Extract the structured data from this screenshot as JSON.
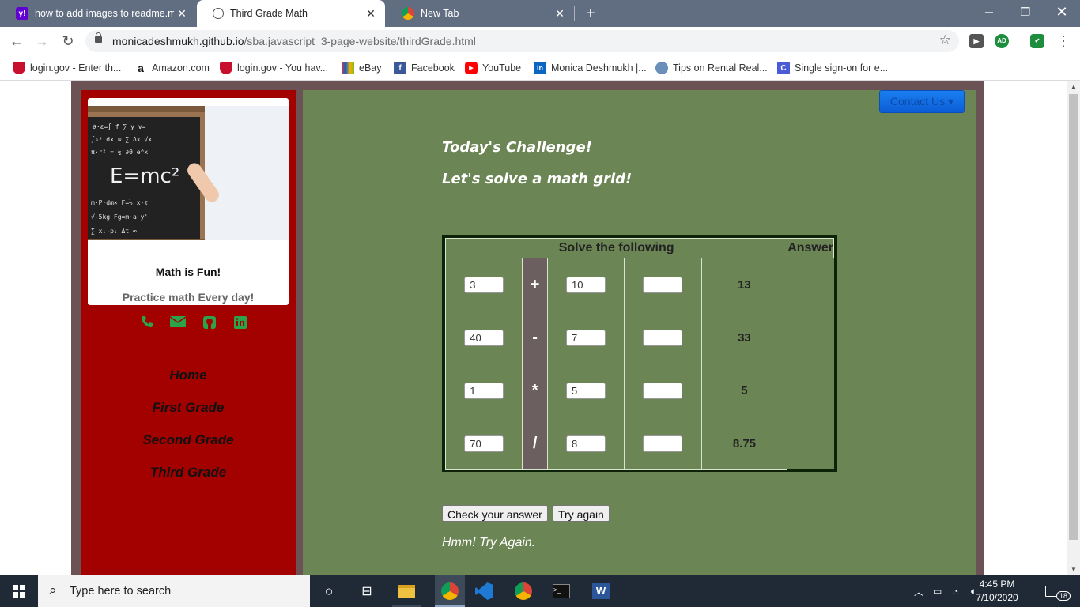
{
  "browser": {
    "tabs": [
      {
        "label": "how to add images to readme.m",
        "favicon": "yahoo-icon",
        "active": false
      },
      {
        "label": "Third Grade Math",
        "favicon": "globe-icon",
        "active": true
      },
      {
        "label": "New Tab",
        "favicon": "chrome-icon",
        "active": false
      }
    ],
    "url_host": "monicadeshmukh.github.io",
    "url_path": "/sba.javascript_3-page-website/thirdGrade.html",
    "profile_initials": "AD",
    "bookmarks": [
      {
        "label": "login.gov - Enter th...",
        "icon": "shield-icon"
      },
      {
        "label": "Amazon.com",
        "icon": "amazon-icon"
      },
      {
        "label": "login.gov - You hav...",
        "icon": "shield-icon"
      },
      {
        "label": "eBay",
        "icon": "shopping-bag-icon"
      },
      {
        "label": "Facebook",
        "icon": "facebook-icon"
      },
      {
        "label": "YouTube",
        "icon": "youtube-icon"
      },
      {
        "label": "Monica Deshmukh |...",
        "icon": "linkedin-icon"
      },
      {
        "label": "Tips on Rental Real...",
        "icon": "globe-icon"
      },
      {
        "label": "Single sign-on for e...",
        "icon": "sso-icon"
      }
    ]
  },
  "sidebar": {
    "card_title": "Math is Fun!",
    "card_subtitle": "Practice math Every day!",
    "image_text": "E=mc²",
    "social_icons": [
      "phone-icon",
      "mail-icon",
      "github-icon",
      "linkedin-icon"
    ],
    "nav": [
      "Home",
      "First Grade",
      "Second Grade",
      "Third Grade"
    ]
  },
  "main": {
    "contact_label": "Contact Us",
    "heading1": "Today's Challenge!",
    "heading2": "Let's solve a math grid!",
    "grid": {
      "header_solve": "Solve the following",
      "header_answer": "Answer",
      "rows": [
        {
          "a": "3",
          "op": "+",
          "b": "10",
          "c": "",
          "answer": "13"
        },
        {
          "a": "40",
          "op": "-",
          "b": "7",
          "c": "",
          "answer": "33"
        },
        {
          "a": "1",
          "op": "*",
          "b": "5",
          "c": "",
          "answer": "5"
        },
        {
          "a": "70",
          "op": "/",
          "b": "8",
          "c": "",
          "answer": "8.75"
        }
      ]
    },
    "check_button": "Check your answer",
    "try_button": "Try again",
    "result_text": "Hmm! Try Again."
  },
  "taskbar": {
    "search_placeholder": "Type here to search",
    "time": "4:45 PM",
    "date": "7/10/2020",
    "notification_count": "18"
  },
  "colors": {
    "sidebar_bg": "#a30000",
    "main_bg": "#6b8555",
    "operator_bg": "#6b5f5f",
    "accent_green": "#2aa34a"
  }
}
